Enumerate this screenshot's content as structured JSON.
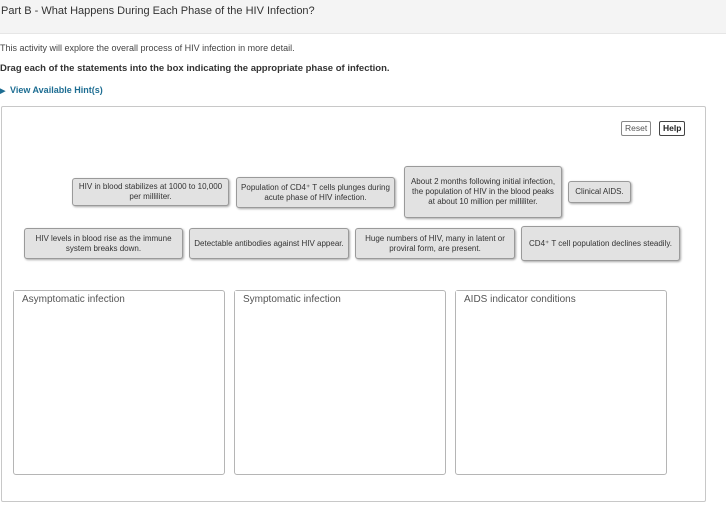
{
  "header": {
    "title": "Part B - What Happens During Each Phase of the HIV Infection?"
  },
  "intro_text": "This activity will explore the overall process of HIV infection in more detail.",
  "instruction_text": "Drag each of the statements into the box indicating the appropriate phase of infection.",
  "hint": {
    "label": "View Available Hint(s)",
    "icon": "triangle-right-icon"
  },
  "toolbar": {
    "reset_label": "Reset",
    "help_label": "Help"
  },
  "tiles": [
    "HIV in blood stabilizes at 1000 to 10,000 per milliliter.",
    "Population of CD4⁺ T cells plunges during acute phase of HIV infection.",
    "About 2 months following initial infection, the population of HIV in the blood peaks at about 10 million per milliliter.",
    "Clinical AIDS.",
    "HIV levels in blood rise as the immune system breaks down.",
    "Detectable antibodies against HIV appear.",
    "Huge numbers of HIV, many in latent or proviral form, are present.",
    "CD4⁺ T cell population declines steadily."
  ],
  "drop_zones": [
    "Asymptomatic infection",
    "Symptomatic infection",
    "AIDS indicator conditions"
  ]
}
